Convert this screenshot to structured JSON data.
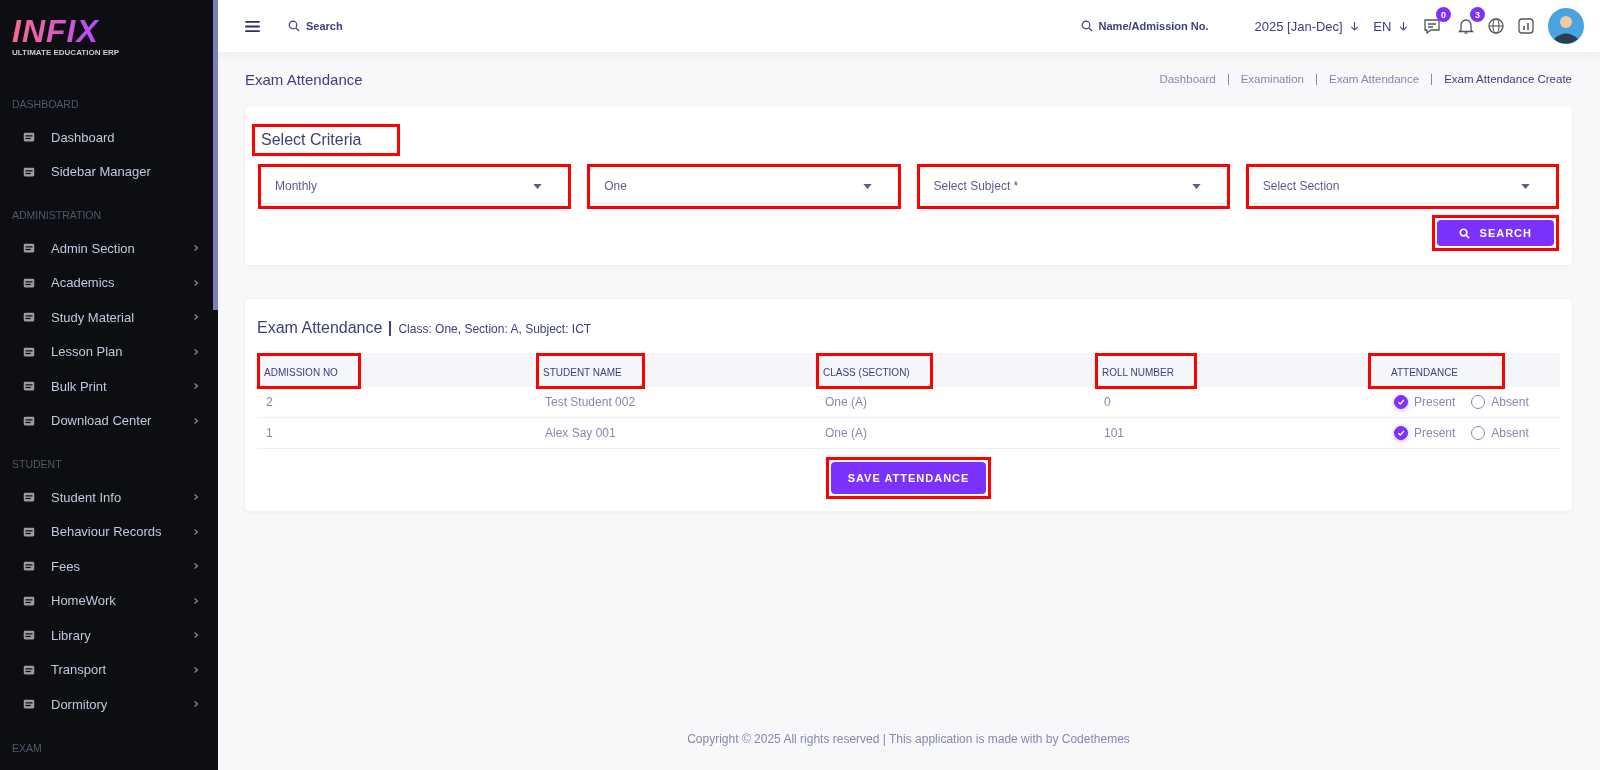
{
  "logo": {
    "text": "INFIX",
    "tagline": "ULTIMATE EDUCATION ERP"
  },
  "sidebar": {
    "sections": [
      {
        "title": "DASHBOARD",
        "items": [
          {
            "label": "Dashboard",
            "has_submenu": false
          },
          {
            "label": "Sidebar Manager",
            "has_submenu": false
          }
        ]
      },
      {
        "title": "ADMINISTRATION",
        "items": [
          {
            "label": "Admin Section",
            "has_submenu": true
          },
          {
            "label": "Academics",
            "has_submenu": true
          },
          {
            "label": "Study Material",
            "has_submenu": true
          },
          {
            "label": "Lesson Plan",
            "has_submenu": true
          },
          {
            "label": "Bulk Print",
            "has_submenu": true
          },
          {
            "label": "Download Center",
            "has_submenu": true
          }
        ]
      },
      {
        "title": "STUDENT",
        "items": [
          {
            "label": "Student Info",
            "has_submenu": true
          },
          {
            "label": "Behaviour Records",
            "has_submenu": true
          },
          {
            "label": "Fees",
            "has_submenu": true
          },
          {
            "label": "HomeWork",
            "has_submenu": true
          },
          {
            "label": "Library",
            "has_submenu": true
          },
          {
            "label": "Transport",
            "has_submenu": true
          },
          {
            "label": "Dormitory",
            "has_submenu": true
          }
        ]
      },
      {
        "title": "EXAM"
      }
    ]
  },
  "header": {
    "search_placeholder": "Search",
    "student_search_placeholder": "Name/Admission No.",
    "session": "2025 [Jan-Dec]",
    "language": "EN",
    "messages_badge": "0",
    "notifications_badge": "3"
  },
  "page": {
    "title": "Exam Attendance",
    "breadcrumbs": [
      {
        "label": "Dashboard",
        "current": false
      },
      {
        "label": "Examination",
        "current": false
      },
      {
        "label": "Exam Attendance",
        "current": false
      },
      {
        "label": "Exam Attendance Create",
        "current": true
      }
    ]
  },
  "criteria": {
    "title": {
      "text": "Select Criteria",
      "highlighted": true
    },
    "selects": [
      {
        "value": "Monthly",
        "highlighted": true
      },
      {
        "value": "One",
        "highlighted": true
      },
      {
        "placeholder": "Select Subject *",
        "highlighted": true
      },
      {
        "placeholder": "Select Section",
        "highlighted": true
      }
    ],
    "search_button": {
      "label": "SEARCH",
      "highlighted": true
    }
  },
  "attendance": {
    "title": "Exam Attendance",
    "details": "Class: One, Section: A, Subject: ICT",
    "table": {
      "columns": [
        {
          "label": "ADMISSION NO",
          "highlighted": true
        },
        {
          "label": "STUDENT NAME",
          "highlighted": true
        },
        {
          "label": "CLASS (SECTION)",
          "highlighted": true
        },
        {
          "label": "ROLL NUMBER",
          "highlighted": true
        },
        {
          "label": "ATTENDANCE",
          "highlighted": true
        }
      ],
      "rows": [
        {
          "admission_no": "2",
          "student_name": "Test Student 002",
          "class_section": "One (A)",
          "roll_number": "0",
          "options": [
            {
              "label": "Present",
              "selected": true
            },
            {
              "label": "Absent",
              "selected": false
            }
          ]
        },
        {
          "admission_no": "1",
          "student_name": "Alex Say 001",
          "class_section": "One (A)",
          "roll_number": "101",
          "options": [
            {
              "label": "Present",
              "selected": true
            },
            {
              "label": "Absent",
              "selected": false
            }
          ]
        }
      ]
    },
    "save_button": {
      "label": "SAVE ATTENDANCE",
      "highlighted": true
    }
  },
  "footer": "Copyright © 2025 All rights reserved | This application is made with by Codethemes"
}
